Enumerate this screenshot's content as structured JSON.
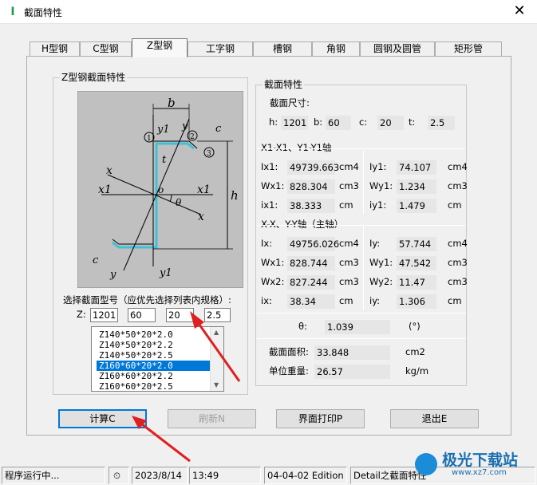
{
  "window": {
    "title": "截面特性",
    "close_glyph": "✕",
    "app_icon_glyph": "I"
  },
  "tabs": [
    {
      "label": "H型钢"
    },
    {
      "label": "C型钢"
    },
    {
      "label": "Z型钢"
    },
    {
      "label": "工字钢"
    },
    {
      "label": "槽钢"
    },
    {
      "label": "角钢"
    },
    {
      "label": "圆钢及圆管"
    },
    {
      "label": "矩形管"
    }
  ],
  "active_tab": "Z型钢",
  "left_group": {
    "title": "Z型钢截面特性",
    "diagram_labels": {
      "b": "b",
      "y1_top": "y1",
      "y_top": "y",
      "c_top": "c",
      "n1": "1",
      "n2": "2",
      "n3": "3",
      "t": "t",
      "x": "x",
      "x1_left": "x1",
      "o": "o",
      "x1_right": "x1",
      "theta": "θ",
      "x_bottom": "x",
      "h": "h",
      "c_bottom": "c",
      "y_bottom": "y",
      "y1_bottom": "y1"
    },
    "select_label": "选择截面型号（应优先选择列表内规格）:",
    "z_label": "Z:",
    "inputs": [
      "1201",
      "60",
      "20",
      "2.5"
    ],
    "list_items": [
      "Z140*50*20*2.0",
      "Z140*50*20*2.2",
      "Z140*50*20*2.5",
      "Z160*60*20*2.0",
      "Z160*60*20*2.2",
      "Z160*60*20*2.5"
    ],
    "selected_index": 3
  },
  "right_group": {
    "title": "截面特性",
    "dims_label": "截面尺寸:",
    "dims": [
      {
        "label": "h:",
        "value": "1201"
      },
      {
        "label": "b:",
        "value": "60"
      },
      {
        "label": "c:",
        "value": "20"
      },
      {
        "label": "t:",
        "value": "2.5"
      }
    ],
    "x1_section_title": "X1-X1、Y1-Y1轴",
    "x1_rows": [
      {
        "l1": "Ix1:",
        "v1": "49739.663",
        "u1": "cm4",
        "l2": "Iy1:",
        "v2": "74.107",
        "u2": "cm4"
      },
      {
        "l1": "Wx1:",
        "v1": "828.304",
        "u1": "cm3",
        "l2": "Wy1:",
        "v2": "1.234",
        "u2": "cm3"
      },
      {
        "l1": "ix1:",
        "v1": "38.333",
        "u1": "cm",
        "l2": "iy1:",
        "v2": "1.479",
        "u2": "cm"
      }
    ],
    "xx_section_title": "X-X、Y-Y轴（主轴）",
    "xx_rows": [
      {
        "l1": "Ix:",
        "v1": "49756.026",
        "u1": "cm4",
        "l2": "Iy:",
        "v2": "57.744",
        "u2": "cm4"
      },
      {
        "l1": "Wx1:",
        "v1": "828.744",
        "u1": "cm3",
        "l2": "Wy1:",
        "v2": "47.542",
        "u2": "cm3"
      },
      {
        "l1": "Wx2:",
        "v1": "827.244",
        "u1": "cm3",
        "l2": "Wy2:",
        "v2": "11.47",
        "u2": "cm3"
      },
      {
        "l1": "ix:",
        "v1": "38.34",
        "u1": "cm",
        "l2": "iy:",
        "v2": "1.306",
        "u2": "cm"
      }
    ],
    "theta": {
      "label": "θ:",
      "value": "1.039",
      "unit": "(°)"
    },
    "area": {
      "label": "截面面积:",
      "value": "33.848",
      "unit": "cm2"
    },
    "weight": {
      "label": "单位重量:",
      "value": "26.57",
      "unit": "kg/m"
    }
  },
  "buttons": {
    "calc": "计算C",
    "refresh": "刷新N",
    "print": "界面打印P",
    "exit": "退出E"
  },
  "statusbar": {
    "status": "程序运行中...",
    "date": "2023/8/14",
    "time": "13:49",
    "edition": "04-04-02 Edition",
    "detail": "Detail之截面特性"
  },
  "watermark": {
    "text_cn": "极光下载站",
    "text_url": "www.xz7.com"
  },
  "colors": {
    "accent": "#0078d7",
    "arrow": "#e02020",
    "diagram_bg": "#c0c0c0",
    "section_line": "#40c0d8"
  }
}
